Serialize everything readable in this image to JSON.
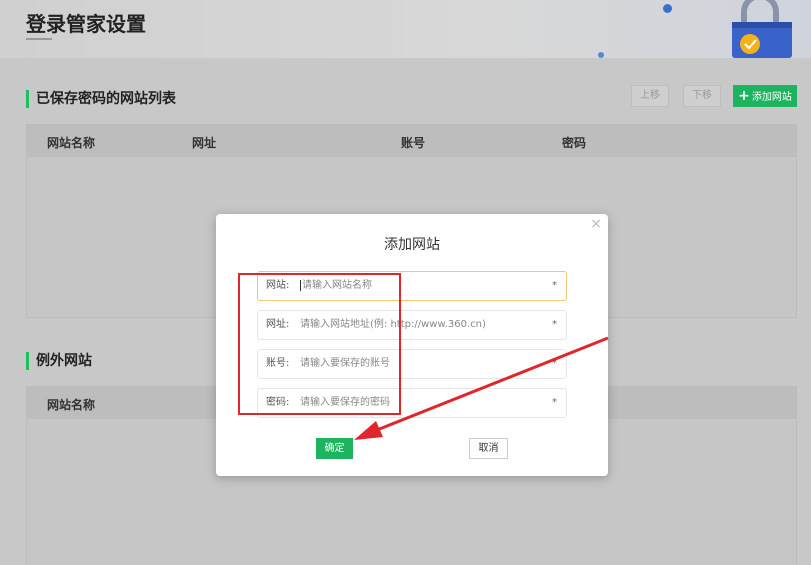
{
  "page": {
    "title": "登录管家设置"
  },
  "saved_sites": {
    "title": "已保存密码的网站列表",
    "move_up_label": "上移",
    "move_down_label": "下移",
    "add_label": "添加网站",
    "columns": [
      "网站名称",
      "网址",
      "账号",
      "密码"
    ]
  },
  "exceptions": {
    "title": "例外网站",
    "columns": [
      "网站名称"
    ]
  },
  "dialog": {
    "title": "添加网站",
    "close_glyph": "×",
    "fields": [
      {
        "label": "网站:",
        "placeholder": "请输入网站名称",
        "required": "*"
      },
      {
        "label": "网址:",
        "placeholder": "请输入网站地址(例: http://www.360.cn)",
        "required": "*"
      },
      {
        "label": "账号:",
        "placeholder": "请输入要保存的账号",
        "required": "*"
      },
      {
        "label": "密码:",
        "placeholder": "请输入要保存的密码",
        "required": "*"
      }
    ],
    "confirm_label": "确定",
    "cancel_label": "取消"
  },
  "colors": {
    "accent": "#1db35f",
    "annotation": "#e0262a"
  }
}
